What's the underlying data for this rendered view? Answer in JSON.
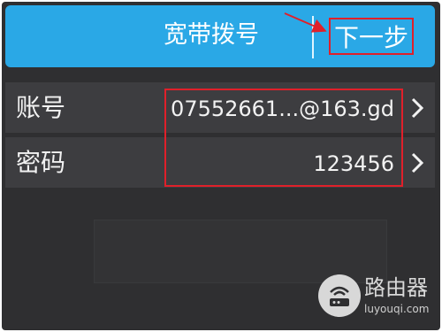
{
  "header": {
    "title": "宽带拨号",
    "next_label": "下一步"
  },
  "rows": [
    {
      "label": "账号",
      "value": "07552661...@163.gd"
    },
    {
      "label": "密码",
      "value": "123456"
    }
  ],
  "watermark": {
    "name": "路由器",
    "url": "luyouqi.com"
  },
  "colors": {
    "header": "#2aa8e6",
    "background": "#2f2f31",
    "highlight": "#e0202a"
  }
}
